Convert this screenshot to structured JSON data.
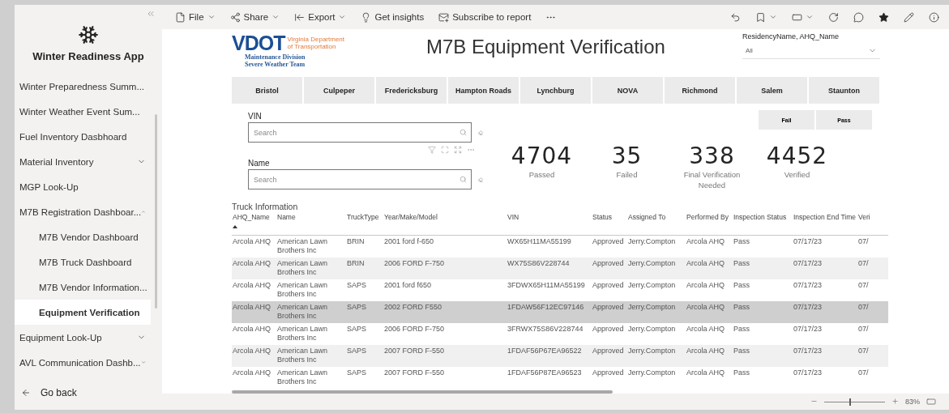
{
  "sidebar": {
    "app_title": "Winter Readiness App",
    "items": [
      {
        "label": "Winter Preparedness Summ...",
        "selected": false
      },
      {
        "label": "Winter Weather Event Sum...",
        "selected": false
      },
      {
        "label": "Fuel Inventory Dasbhoard",
        "selected": false
      },
      {
        "label": "Material Inventory",
        "selected": false,
        "expanded": false
      },
      {
        "label": "MGP Look-Up",
        "selected": false
      },
      {
        "label": "M7B Registration Dashboar...",
        "selected": false,
        "expanded": true,
        "children": [
          {
            "label": "M7B Vendor Dashboard",
            "selected": false
          },
          {
            "label": "M7B Truck Dashboard",
            "selected": false
          },
          {
            "label": "M7B Vendor Information...",
            "selected": false
          },
          {
            "label": "Equipment Verification",
            "selected": true
          }
        ]
      },
      {
        "label": "Equipment Look-Up",
        "selected": false,
        "expanded": false
      },
      {
        "label": "AVL Communication Dashb...",
        "selected": false,
        "expanded": false
      }
    ],
    "back": "Go back"
  },
  "toolbar": {
    "items": [
      {
        "label": "File",
        "menu": true
      },
      {
        "label": "Share",
        "menu": true
      },
      {
        "label": "Export",
        "menu": true
      },
      {
        "label": "Get insights",
        "menu": false
      },
      {
        "label": "Subscribe to report",
        "menu": false
      }
    ]
  },
  "logo": {
    "mark": "VDOT",
    "agency": [
      "Virginia Department",
      "of Transportation"
    ],
    "division": [
      "Maintenance Division",
      "Severe Weather Team"
    ]
  },
  "title": "M7B Equipment Verification",
  "slicer": {
    "label": "ResidencyName, AHQ_Name",
    "value": "All"
  },
  "regions": [
    {
      "label": "Bristol",
      "selected": false
    },
    {
      "label": "Culpeper",
      "selected": false
    },
    {
      "label": "Fredericksburg",
      "selected": false
    },
    {
      "label": "Hampton Roads",
      "selected": false
    },
    {
      "label": "Lynchburg",
      "selected": false
    },
    {
      "label": "NOVA",
      "selected": false
    },
    {
      "label": "Richmond",
      "selected": false
    },
    {
      "label": "Salem",
      "selected": false
    },
    {
      "label": "Staunton",
      "selected": false
    }
  ],
  "result_filter": [
    {
      "label": "Fail",
      "selected": false
    },
    {
      "label": "Pass",
      "selected": false
    }
  ],
  "fields": [
    {
      "label": "VIN",
      "placeholder": "Search"
    },
    {
      "label": "Name",
      "placeholder": "Search"
    }
  ],
  "kpis": [
    {
      "value": "4704",
      "label": "Passed"
    },
    {
      "value": "35",
      "label": "Failed"
    },
    {
      "value": "338",
      "label": "Final Verification Needed"
    },
    {
      "value": "4452",
      "label": "Verified"
    }
  ],
  "table": {
    "title": "Truck Information",
    "columns": [
      {
        "label": "AHQ_Name",
        "sorted": true
      },
      {
        "label": "Name",
        "sorted": false
      },
      {
        "label": "TruckType",
        "sorted": false
      },
      {
        "label": "Year/Make/Model",
        "sorted": false
      },
      {
        "label": "VIN",
        "sorted": false
      },
      {
        "label": "Status",
        "sorted": false
      },
      {
        "label": "Assigned To",
        "sorted": false
      },
      {
        "label": "Performed By",
        "sorted": false
      },
      {
        "label": "Inspection Status",
        "sorted": false
      },
      {
        "label": "Inspection End Time",
        "sorted": false
      },
      {
        "label": "Veri",
        "sorted": false
      }
    ],
    "rows": [
      {
        "selected": false,
        "cells": [
          "Arcola AHQ",
          "American Lawn Brothers Inc",
          "BRIN",
          "2001 ford f-650",
          "WX65H11MA55199",
          "Approved",
          "Jerry.Compton",
          "Arcola AHQ",
          "Pass",
          "07/17/23",
          "07/"
        ]
      },
      {
        "selected": false,
        "cells": [
          "Arcola AHQ",
          "American Lawn Brothers Inc",
          "BRIN",
          "2006 FORD F-750",
          "WX75S86V228744",
          "Approved",
          "Jerry.Compton",
          "Arcola AHQ",
          "Pass",
          "07/17/23",
          "07/"
        ]
      },
      {
        "selected": false,
        "cells": [
          "Arcola AHQ",
          "American Lawn Brothers Inc",
          "SAPS",
          "2001 ford f650",
          "3FDWX65H11MA55199",
          "Approved",
          "Jerry.Compton",
          "Arcola AHQ",
          "Pass",
          "07/17/23",
          "07/"
        ]
      },
      {
        "selected": true,
        "cells": [
          "Arcola AHQ",
          "American Lawn Brothers Inc",
          "SAPS",
          "2002 FORD F550",
          "1FDAW56F12EC97146",
          "Approved",
          "Jerry.Compton",
          "Arcola AHQ",
          "Pass",
          "07/17/23",
          "07/"
        ]
      },
      {
        "selected": false,
        "cells": [
          "Arcola AHQ",
          "American Lawn Brothers Inc",
          "SAPS",
          "2006 FORD F-750",
          "3FRWX75S86V228744",
          "Approved",
          "Jerry.Compton",
          "Arcola AHQ",
          "Pass",
          "07/17/23",
          "07/"
        ]
      },
      {
        "selected": false,
        "cells": [
          "Arcola AHQ",
          "American Lawn Brothers Inc",
          "SAPS",
          "2007 FORD F-550",
          "1FDAF56P67EA96522",
          "Approved",
          "Jerry.Compton",
          "Arcola AHQ",
          "Pass",
          "07/17/23",
          "07/"
        ]
      },
      {
        "selected": false,
        "cells": [
          "Arcola AHQ",
          "American Lawn Brothers Inc",
          "SAPS",
          "2007 FORD F-550",
          "1FDAF56P87EA96523",
          "Approved",
          "Jerry.Compton",
          "Arcola AHQ",
          "Pass",
          "07/17/23",
          "07/"
        ]
      }
    ]
  },
  "zoom": {
    "level": 0.42,
    "reading": "83%"
  }
}
